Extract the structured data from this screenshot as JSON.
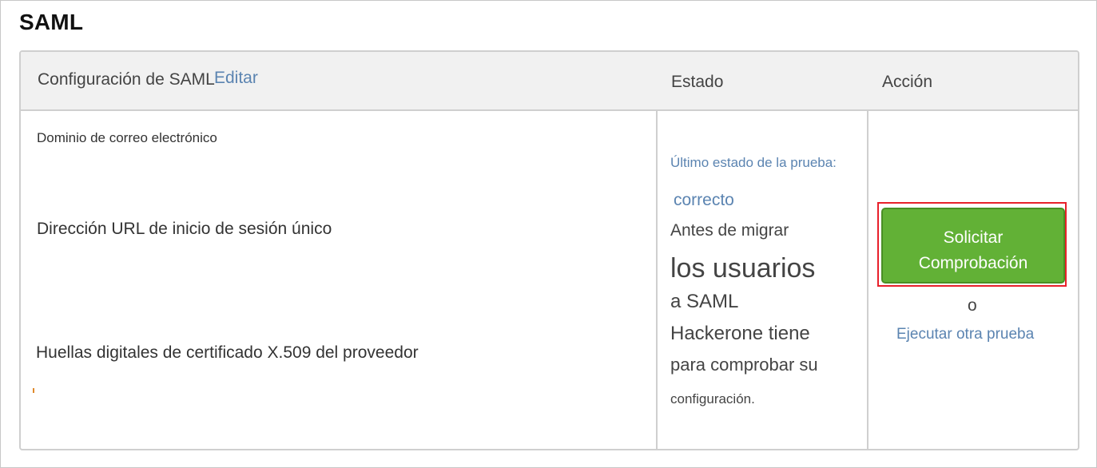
{
  "section": {
    "title": "SAML"
  },
  "header": {
    "config_label": "Configuración de SAML",
    "edit_link": "Editar",
    "status_label": "Estado",
    "action_label": "Acción"
  },
  "fields": {
    "email_domain": "Dominio de correo electrónico",
    "sso_url": "Dirección URL de inicio de sesión único",
    "cert_fingerprint": "Huellas digitales de certificado X.509 del proveedor"
  },
  "status": {
    "last_test_label": "Último estado de la prueba:",
    "result": "correcto",
    "line1": "Antes de migrar",
    "line2": "los usuarios",
    "line3": "a SAML",
    "line4": "Hackerone tiene",
    "line5": "para comprobar su",
    "line6": "configuración."
  },
  "action": {
    "request_line1": "Solicitar",
    "request_line2": "Comprobación",
    "or_text": "o",
    "rerun_link": "Ejecutar otra prueba"
  },
  "colors": {
    "link": "#5b84b1",
    "button_bg": "#62b136",
    "highlight_border": "#e8202a",
    "header_bg": "#f1f1f1"
  }
}
